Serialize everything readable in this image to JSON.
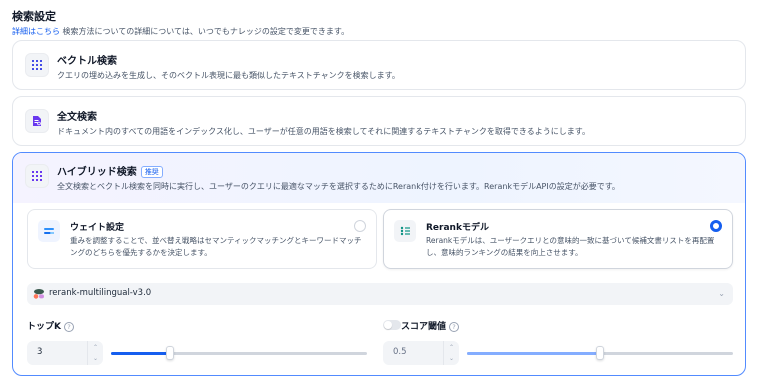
{
  "section": {
    "title": "検索設定",
    "link_text": "詳細はこちら",
    "desc": " 検索方法についての詳細については、いつでもナレッジの設定で変更できます。"
  },
  "methods": [
    {
      "title": "ベクトル検索",
      "desc": "クエリの埋め込みを生成し、そのベクトル表現に最も類似したテキストチャンクを検索します。",
      "icon": "vector-grid-icon"
    },
    {
      "title": "全文検索",
      "desc": "ドキュメント内のすべての用語をインデックス化し、ユーザーが任意の用語を検索してそれに関連するテキストチャンクを取得できるようにします。",
      "icon": "fulltext-doc-icon"
    },
    {
      "title": "ハイブリッド検索",
      "badge": "推奨",
      "desc": "全文検索とベクトル検索を同時に実行し、ユーザーのクエリに最適なマッチを選択するためにRerank付けを行います。RerankモデルAPIの設定が必要です。",
      "icon": "hybrid-grid-icon",
      "selected": true
    }
  ],
  "hybrid": {
    "weight": {
      "title": "ウェイト設定",
      "desc": "重みを調整することで、並べ替え戦略はセマンティックマッチングとキーワードマッチングのどちらを優先するかを決定します。",
      "selected": false
    },
    "rerank": {
      "title": "Rerankモデル",
      "desc": "Rerankモデルは、ユーザークエリとの意味的一致に基づいて候補文書リストを再配置し、意味的ランキングの結果を向上させます。",
      "selected": true
    },
    "model": {
      "name": "rerank-multilingual-v3.0"
    },
    "top_k": {
      "label": "トップK",
      "value": "3",
      "slider_fraction": 0.23
    },
    "score_threshold": {
      "label": "スコア閾値",
      "value": "0.5",
      "enabled": false,
      "slider_fraction": 0.5
    }
  },
  "colors": {
    "accent": "#155eef",
    "selected_border": "#528bff"
  }
}
